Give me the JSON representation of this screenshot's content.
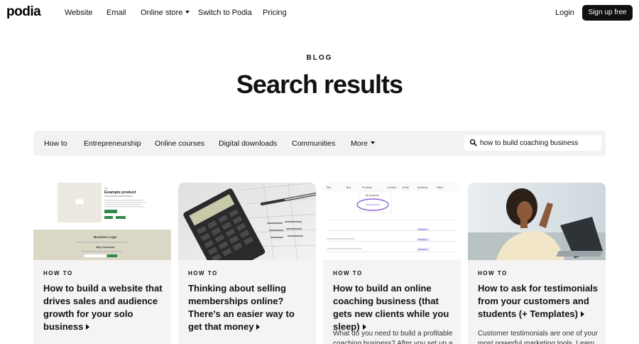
{
  "nav": {
    "logo": "podia",
    "links": [
      "Website",
      "Email",
      "Online store",
      "Switch to Podia",
      "Pricing"
    ],
    "login": "Login",
    "signup": "Sign up free"
  },
  "hero": {
    "eyebrow": "BLOG",
    "title": "Search results"
  },
  "filters": {
    "categories": [
      "How to",
      "Entrepreneurship",
      "Online courses",
      "Digital downloads",
      "Communities",
      "More"
    ],
    "search_value": "how to build coaching business"
  },
  "cards": [
    {
      "tag": "HOW TO",
      "title": "How to build a website that drives sales and audience growth for your solo business",
      "excerpt": "",
      "thumb_texts": [
        "Example product",
        "Business Logo",
        "Stay Connected"
      ]
    },
    {
      "tag": "HOW TO",
      "title": "Thinking about selling memberships online? There's an easier way to get that money",
      "excerpt": ""
    },
    {
      "tag": "HOW TO",
      "title": "How to build an online coaching business (that gets new clients while you sleep)",
      "excerpt": "What do you need to build a profitable coaching business? After you set up a",
      "thumb_texts": [
        "Site",
        "Buy",
        "Products",
        "Content",
        "Email",
        "Audience",
        "Sales",
        "All products",
        "New product",
        "Published",
        "Published",
        "Published"
      ]
    },
    {
      "tag": "HOW TO",
      "title": "How to ask for testimonials from your customers and students (+ Templates)",
      "excerpt": "Customer testimonials are one of your most powerful marketing tools. Learn"
    }
  ],
  "colors": {
    "text": "#111111",
    "button_bg": "#111111",
    "filter_bg": "#f2f2f2",
    "card_bg": "#f4f4f4",
    "accent_purple": "#8a63d2",
    "green": "#2f8a4a"
  }
}
